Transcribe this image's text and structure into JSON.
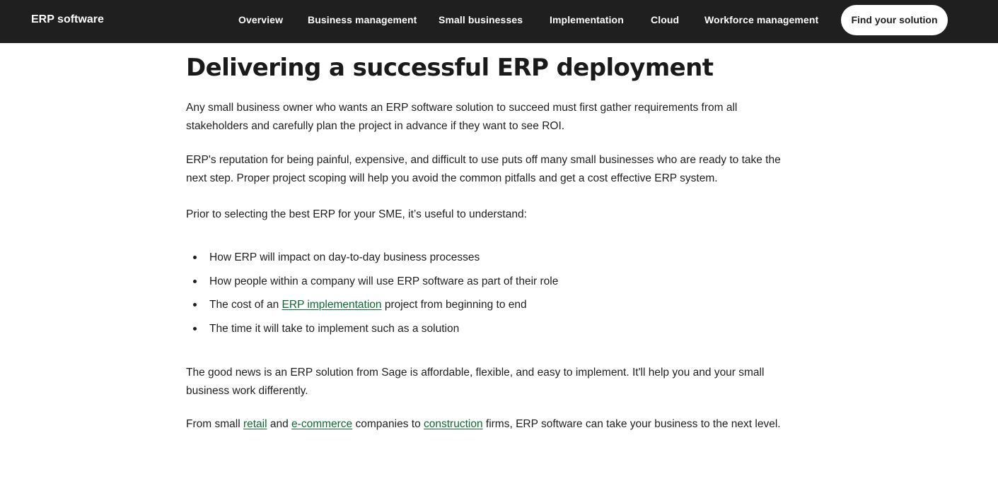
{
  "nav": {
    "brand": "ERP software",
    "items": [
      {
        "label": "Overview"
      },
      {
        "label": "Business management"
      },
      {
        "label": "Small businesses"
      },
      {
        "label": "Implementation"
      },
      {
        "label": "Cloud"
      },
      {
        "label": "Workforce management"
      }
    ],
    "cta": "Find your solution"
  },
  "article": {
    "heading": "Delivering a successful ERP deployment",
    "p1": "Any small business owner who wants an ERP software solution to succeed must first gather requirements from all stakeholders and carefully plan the project in advance if they want to see ROI.",
    "p2": "ERP's reputation for being painful, expensive, and difficult to use puts off many small businesses who are ready to take the next step. Proper project scoping will help you avoid the common pitfalls and get a cost effective ERP system.",
    "p3": "Prior to selecting the best ERP for your SME, it’s useful to understand:",
    "list": {
      "item1": "How ERP will impact on day-to-day business processes",
      "item2": "How people within a company will use ERP software as part of their role",
      "item3_before": "The cost of an ",
      "item3_link": "ERP implementation",
      "item3_after": " project from beginning to end",
      "item4": "The time it will take to implement such as a solution"
    },
    "p4": "The good news is an ERP solution from Sage is affordable, flexible, and easy to implement. It'll help you and your small business work differently.",
    "p5": {
      "part1": "From small ",
      "link1": "retail",
      "part2": " and ",
      "link2": "e-commerce",
      "part3": " companies to ",
      "link3": "construction",
      "part4": " firms, ERP software can take your business to the next level."
    }
  },
  "colors": {
    "nav_background": "#1f1f1f",
    "link": "#0b6b2e",
    "text": "#1f1f1f"
  }
}
